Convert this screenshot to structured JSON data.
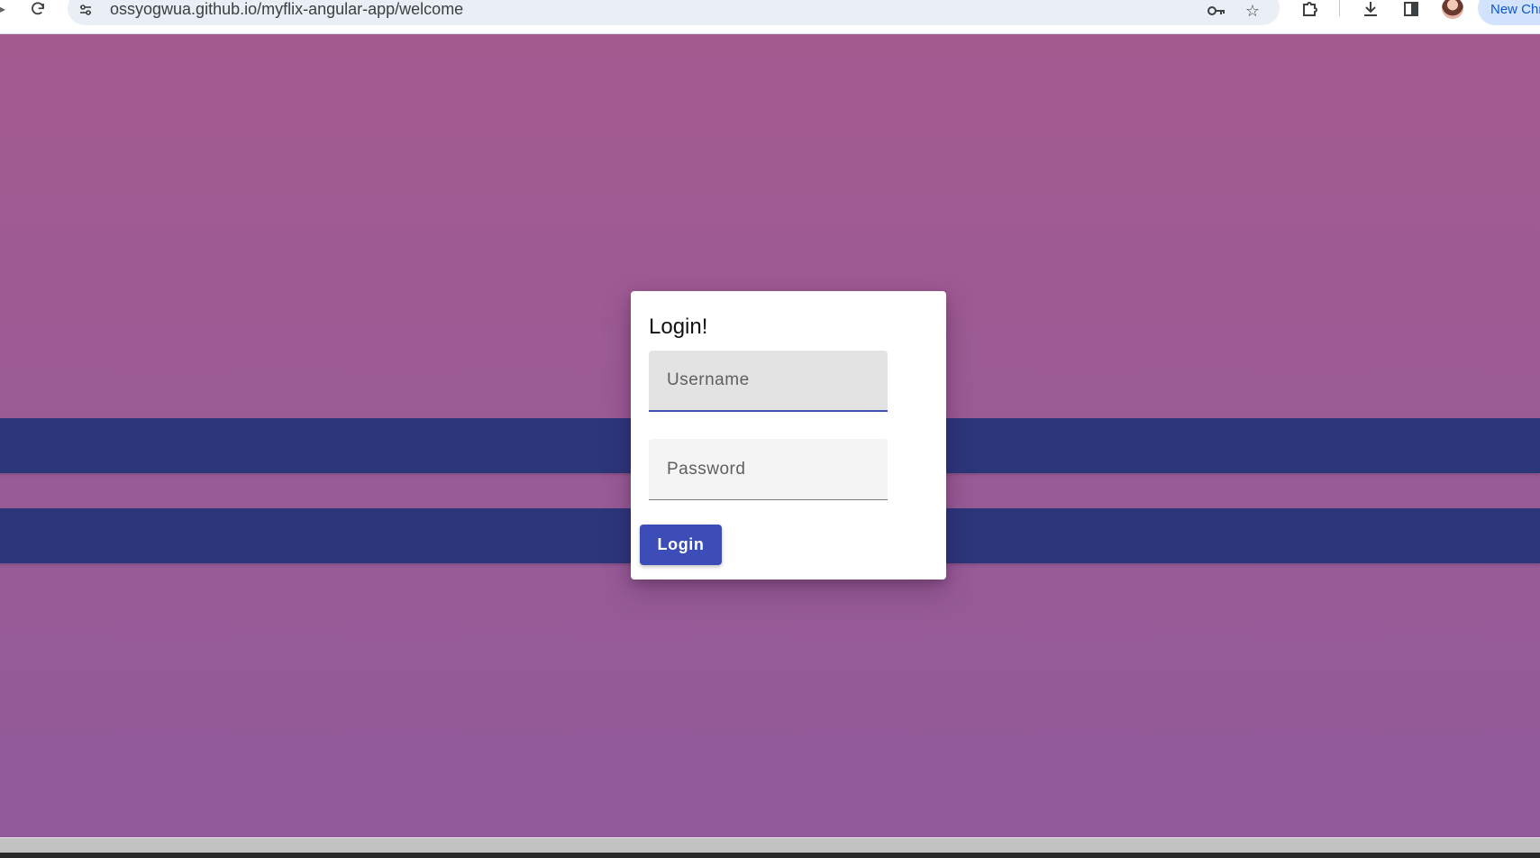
{
  "browser": {
    "url": "ossyogwua.github.io/myflix-angular-app/welcome",
    "reload_icon": "reload-icon",
    "site_info_icon": "tune-icon",
    "password_key_icon": "key-icon",
    "bookmark_icon": "star-icon",
    "extensions_icon": "puzzle-icon",
    "download_icon": "download-icon",
    "side_panel_icon": "side-panel-icon",
    "profile_icon": "avatar",
    "new_chrome_label": "New Chr"
  },
  "login": {
    "title": "Login!",
    "username_placeholder": "Username",
    "password_placeholder": "Password",
    "button_label": "Login"
  },
  "colors": {
    "background_top": "#a35b8f",
    "background_bottom": "#915a9a",
    "stripe": "#2b367b",
    "button": "#3d4db7",
    "field_focus_underline": "#3f51b5"
  }
}
